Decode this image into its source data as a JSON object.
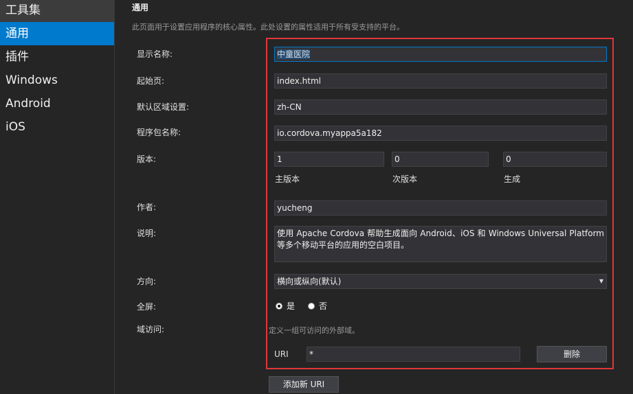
{
  "sidebar": {
    "items": [
      {
        "label": "工具集"
      },
      {
        "label": "通用"
      },
      {
        "label": "插件"
      },
      {
        "label": "Windows"
      },
      {
        "label": "Android"
      },
      {
        "label": "iOS"
      }
    ]
  },
  "section": {
    "title": "通用",
    "description": "此页面用于设置应用程序的核心属性。此处设置的属性适用于所有受支持的平台。"
  },
  "labels": {
    "display_name": "显示名称:",
    "start_page": "起始页:",
    "locale": "默认区域设置:",
    "package_name": "程序包名称:",
    "version": "版本:",
    "author": "作者:",
    "description": "说明:",
    "orientation": "方向:",
    "fullscreen": "全屏:",
    "domain_access": "域访问:"
  },
  "fields": {
    "display_name": "中童医院",
    "start_page": "index.html",
    "locale": "zh-CN",
    "package_name": "io.cordova.myappa5a182",
    "version_major": "1",
    "version_minor": "0",
    "version_build": "0",
    "author": "yucheng",
    "description": "使用 Apache Cordova 帮助生成面向 Android、iOS 和 Windows Universal Platform 等多个移动平台的应用的空白项目。"
  },
  "version_labels": {
    "major": "主版本",
    "minor": "次版本",
    "build": "生成"
  },
  "orientation": {
    "selected": "横向或纵向(默认)"
  },
  "fullscreen": {
    "yes": "是",
    "no": "否",
    "selected": "是"
  },
  "domain_access": {
    "hint": "定义一组可访问的外部域。",
    "uri_label": "URI",
    "uri_value": "*",
    "delete_label": "删除",
    "add_label": "添加新 URI"
  }
}
